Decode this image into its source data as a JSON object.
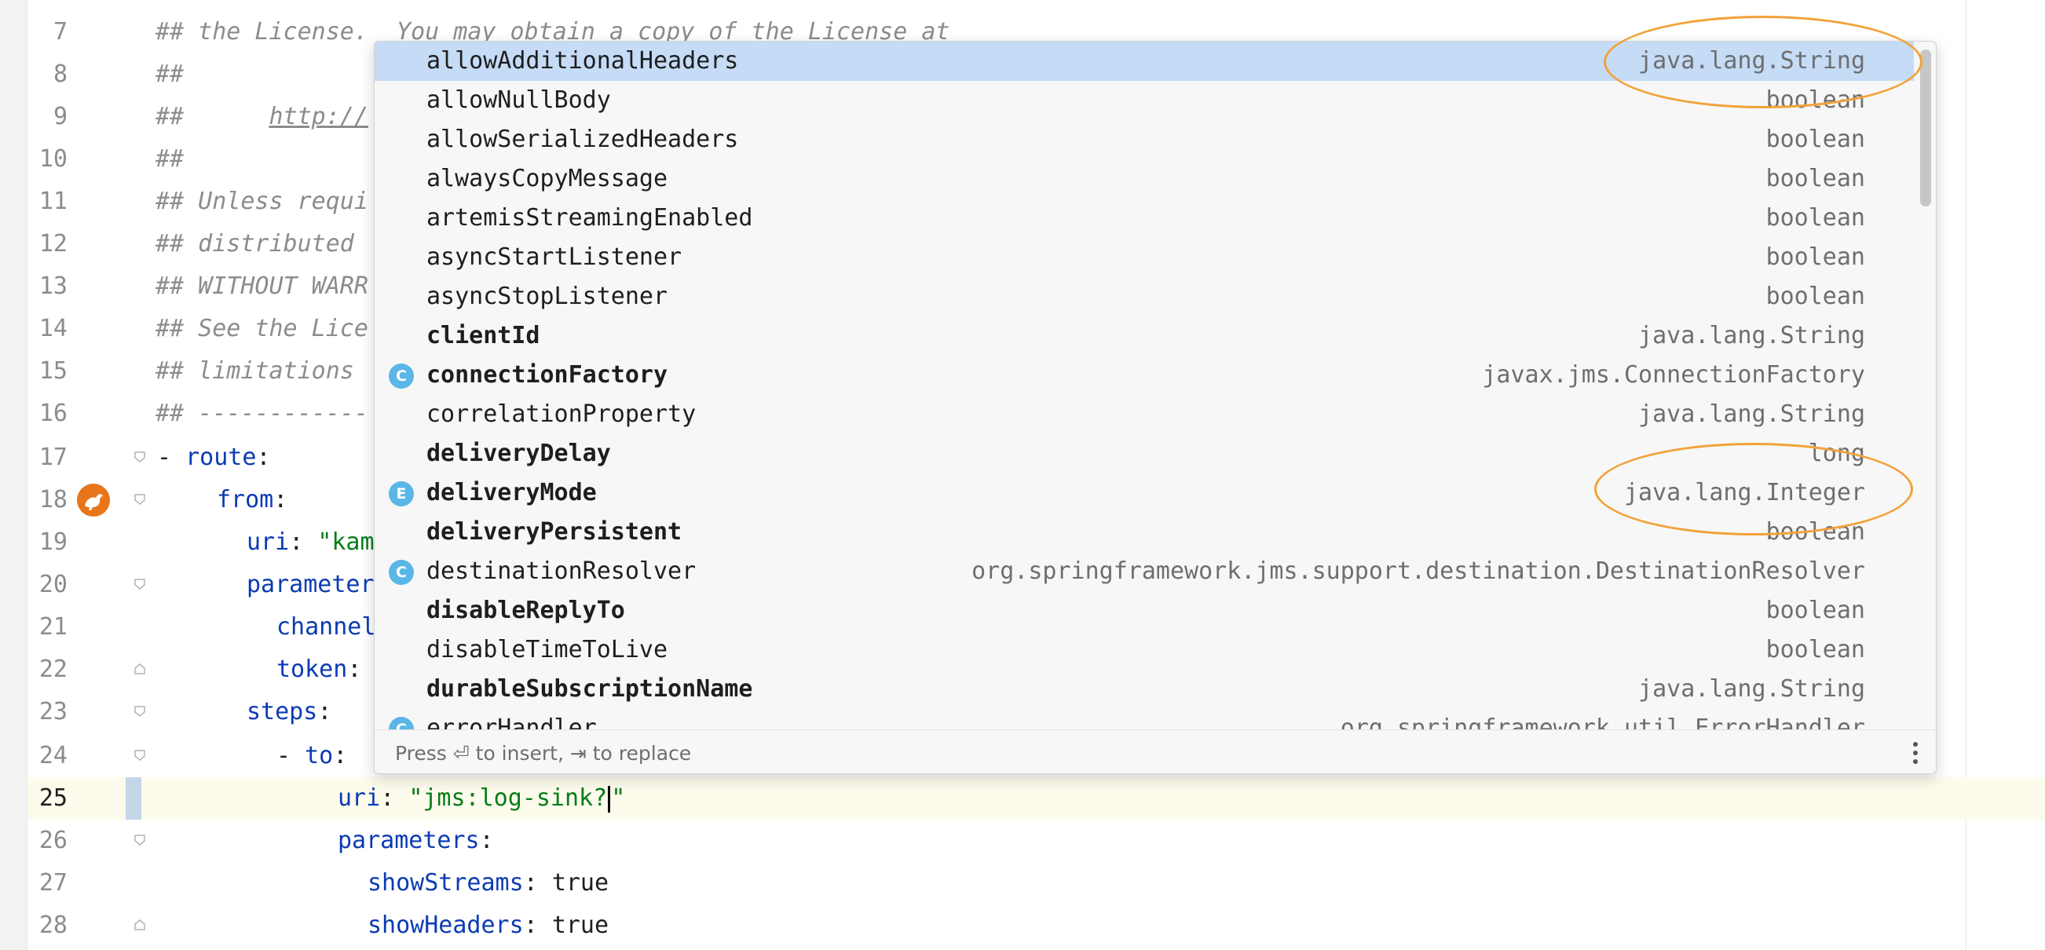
{
  "editor": {
    "lines": [
      {
        "num": "7",
        "comment": "## the License.  You may obtain a copy of the License at"
      },
      {
        "num": "8",
        "comment": "##"
      },
      {
        "num": "9",
        "comment_prefix": "##      ",
        "comment_link": "http://"
      },
      {
        "num": "10",
        "comment": "##"
      },
      {
        "num": "11",
        "comment": "## Unless requi"
      },
      {
        "num": "12",
        "comment": "## distributed"
      },
      {
        "num": "13",
        "comment": "## WITHOUT WARR"
      },
      {
        "num": "14",
        "comment": "## See the Lice"
      },
      {
        "num": "15",
        "comment": "## limitations"
      },
      {
        "num": "16",
        "comment": "## ------------"
      },
      {
        "num": "17",
        "dash": "- ",
        "key": "route",
        "colon": ":"
      },
      {
        "num": "18",
        "key": "from",
        "colon": ":"
      },
      {
        "num": "19",
        "key": "uri",
        "colon": ": ",
        "str": "\"kam"
      },
      {
        "num": "20",
        "key": "parameter"
      },
      {
        "num": "21",
        "key": "channel"
      },
      {
        "num": "22",
        "key": "token",
        "colon": ":"
      },
      {
        "num": "23",
        "key": "steps",
        "colon": ":"
      },
      {
        "num": "24",
        "dash": "- ",
        "key": "to",
        "colon": ":"
      },
      {
        "num": "25",
        "key": "uri",
        "colon": ": ",
        "str_before_caret": "\"jms:log-sink?",
        "str_after_caret": "\""
      },
      {
        "num": "26",
        "key": "parameters",
        "colon": ":"
      },
      {
        "num": "27",
        "key": "showStreams",
        "colon": ": ",
        "value": "true"
      },
      {
        "num": "28",
        "key": "showHeaders",
        "colon": ": ",
        "value": "true"
      }
    ]
  },
  "completion": {
    "items": [
      {
        "name": "allowAdditionalHeaders",
        "type": "java.lang.String",
        "bold": false,
        "icon": "",
        "selected": true
      },
      {
        "name": "allowNullBody",
        "type": "boolean",
        "bold": false,
        "icon": ""
      },
      {
        "name": "allowSerializedHeaders",
        "type": "boolean",
        "bold": false,
        "icon": ""
      },
      {
        "name": "alwaysCopyMessage",
        "type": "boolean",
        "bold": false,
        "icon": ""
      },
      {
        "name": "artemisStreamingEnabled",
        "type": "boolean",
        "bold": false,
        "icon": ""
      },
      {
        "name": "asyncStartListener",
        "type": "boolean",
        "bold": false,
        "icon": ""
      },
      {
        "name": "asyncStopListener",
        "type": "boolean",
        "bold": false,
        "icon": ""
      },
      {
        "name": "clientId",
        "type": "java.lang.String",
        "bold": true,
        "icon": ""
      },
      {
        "name": "connectionFactory",
        "type": "javax.jms.ConnectionFactory",
        "bold": true,
        "icon": "C"
      },
      {
        "name": "correlationProperty",
        "type": "java.lang.String",
        "bold": false,
        "icon": ""
      },
      {
        "name": "deliveryDelay",
        "type": "long",
        "bold": true,
        "icon": ""
      },
      {
        "name": "deliveryMode",
        "type": "java.lang.Integer",
        "bold": true,
        "icon": "E"
      },
      {
        "name": "deliveryPersistent",
        "type": "boolean",
        "bold": true,
        "icon": ""
      },
      {
        "name": "destinationResolver",
        "type": "org.springframework.jms.support.destination.DestinationResolver",
        "bold": false,
        "icon": "C"
      },
      {
        "name": "disableReplyTo",
        "type": "boolean",
        "bold": true,
        "icon": ""
      },
      {
        "name": "disableTimeToLive",
        "type": "boolean",
        "bold": false,
        "icon": ""
      },
      {
        "name": "durableSubscriptionName",
        "type": "java.lang.String",
        "bold": true,
        "icon": ""
      },
      {
        "name": "errorHandler",
        "type": "org.springframework.util.ErrorHandler",
        "bold": false,
        "icon": "C"
      }
    ],
    "hint": "Press ⏎ to insert, ⇥ to replace",
    "icon_color": "#5ab6e6",
    "selection_color": "#c5dbf6",
    "annotation_color": "#f2a23a"
  }
}
